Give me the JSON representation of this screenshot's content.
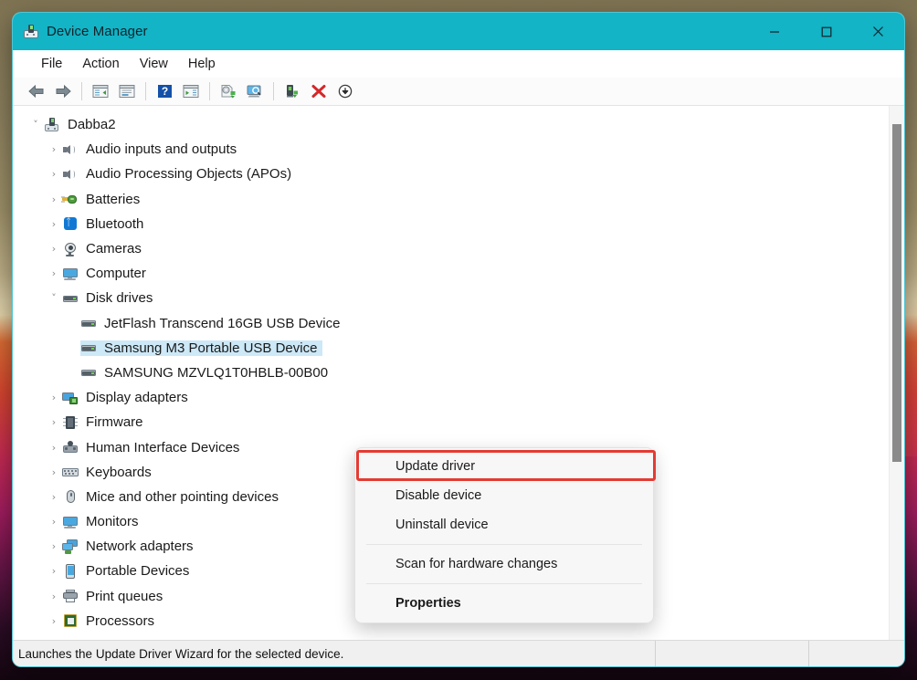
{
  "window": {
    "title": "Device Manager",
    "app_icon": "device-manager-icon",
    "accent_color": "#12b4c6",
    "controls": {
      "minimize": "minimize-button",
      "maximize": "maximize-button",
      "close": "close-button"
    }
  },
  "menubar": {
    "items": [
      {
        "label": "File"
      },
      {
        "label": "Action"
      },
      {
        "label": "View"
      },
      {
        "label": "Help"
      }
    ]
  },
  "toolbar": {
    "buttons": [
      {
        "name": "back-arrow-icon"
      },
      {
        "name": "forward-arrow-icon"
      },
      {
        "name": "show-hide-console-tree-icon"
      },
      {
        "name": "properties-window-icon"
      },
      {
        "name": "help-icon"
      },
      {
        "name": "show-action-pane-icon"
      },
      {
        "name": "update-driver-icon"
      },
      {
        "name": "scan-hardware-changes-icon"
      },
      {
        "name": "enable-device-icon"
      },
      {
        "name": "uninstall-device-icon"
      },
      {
        "name": "disable-device-icon"
      }
    ]
  },
  "tree": {
    "root": {
      "label": "Dabba2",
      "icon": "computer-root-icon",
      "expanded": true
    },
    "nodes": [
      {
        "label": "Audio inputs and outputs",
        "icon": "speaker-icon",
        "depth": 1,
        "expanded": false
      },
      {
        "label": "Audio Processing Objects (APOs)",
        "icon": "speaker-icon",
        "depth": 1,
        "expanded": false
      },
      {
        "label": "Batteries",
        "icon": "battery-icon",
        "depth": 1,
        "expanded": false
      },
      {
        "label": "Bluetooth",
        "icon": "bluetooth-icon",
        "depth": 1,
        "expanded": false
      },
      {
        "label": "Cameras",
        "icon": "camera-icon",
        "depth": 1,
        "expanded": false
      },
      {
        "label": "Computer",
        "icon": "monitor-icon",
        "depth": 1,
        "expanded": false
      },
      {
        "label": "Disk drives",
        "icon": "disk-drive-icon",
        "depth": 1,
        "expanded": true
      },
      {
        "label": "JetFlash Transcend 16GB USB Device",
        "icon": "disk-drive-icon",
        "depth": 2,
        "selected": false
      },
      {
        "label": "Samsung M3 Portable USB Device",
        "icon": "disk-drive-icon",
        "depth": 2,
        "selected": true
      },
      {
        "label": "SAMSUNG MZVLQ1T0HBLB-00B00",
        "icon": "disk-drive-icon",
        "depth": 2,
        "selected": false
      },
      {
        "label": "Display adapters",
        "icon": "display-adapter-icon",
        "depth": 1,
        "expanded": false
      },
      {
        "label": "Firmware",
        "icon": "firmware-chip-icon",
        "depth": 1,
        "expanded": false
      },
      {
        "label": "Human Interface Devices",
        "icon": "hid-icon",
        "depth": 1,
        "expanded": false
      },
      {
        "label": "Keyboards",
        "icon": "keyboard-icon",
        "depth": 1,
        "expanded": false
      },
      {
        "label": "Mice and other pointing devices",
        "icon": "mouse-icon",
        "depth": 1,
        "expanded": false
      },
      {
        "label": "Monitors",
        "icon": "monitor-icon",
        "depth": 1,
        "expanded": false
      },
      {
        "label": "Network adapters",
        "icon": "network-adapter-icon",
        "depth": 1,
        "expanded": false
      },
      {
        "label": "Portable Devices",
        "icon": "portable-device-icon",
        "depth": 1,
        "expanded": false
      },
      {
        "label": "Print queues",
        "icon": "printer-icon",
        "depth": 1,
        "expanded": false
      },
      {
        "label": "Processors",
        "icon": "processor-icon",
        "depth": 1,
        "expanded": false
      }
    ],
    "selection_color": "#cde8f7"
  },
  "context_menu": {
    "highlight_color": "#e33b33",
    "items": [
      {
        "label": "Update driver",
        "highlighted": true,
        "bold": false
      },
      {
        "label": "Disable device",
        "highlighted": false,
        "bold": false
      },
      {
        "label": "Uninstall device",
        "highlighted": false,
        "bold": false
      },
      {
        "separator_after": true
      },
      {
        "label": "Scan for hardware changes",
        "highlighted": false,
        "bold": false
      },
      {
        "separator_after": true
      },
      {
        "label": "Properties",
        "highlighted": false,
        "bold": true
      }
    ]
  },
  "statusbar": {
    "text": "Launches the Update Driver Wizard for the selected device.",
    "pane2": "",
    "pane3": ""
  }
}
